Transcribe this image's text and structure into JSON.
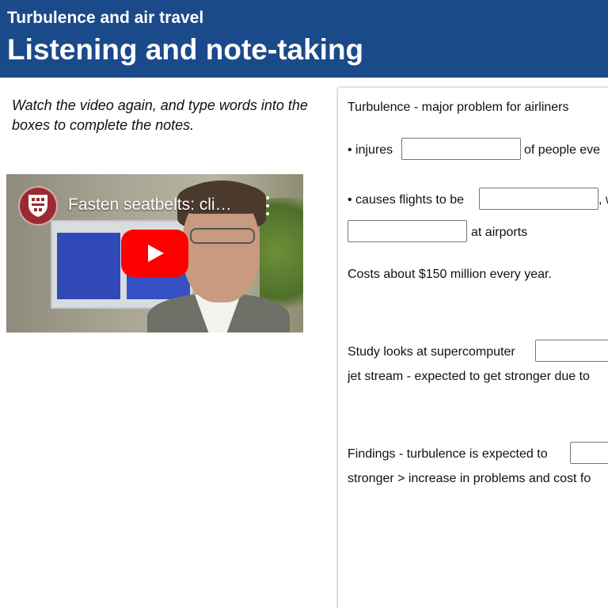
{
  "header": {
    "subtitle": "Turbulence and air travel",
    "title": "Listening and note-taking"
  },
  "instructions": "Watch the video again, and type words into the boxes to complete the notes.",
  "video": {
    "title": "Fasten seatbelts: cli…",
    "channel_icon": "university-crest-icon",
    "play_icon": "youtube-play-icon",
    "more_icon": "more-vertical-icon"
  },
  "notes": {
    "heading": "Turbulence - major problem for airliners",
    "bullet1_prefix": "• injures",
    "bullet1_suffix": "of people eve",
    "bullet2_prefix": "• causes flights to be",
    "bullet2_comma": ", w",
    "bullet2_line2_suffix": "at airports",
    "costs": "Costs about $150 million every year.",
    "study_prefix": "Study looks at supercomputer",
    "study_line2": "jet stream - expected to get stronger due to",
    "findings_prefix": "Findings - turbulence is expected to",
    "findings_line2": "stronger > increase in problems and cost fo"
  },
  "colors": {
    "header_bg": "#1b4a8a",
    "play_red": "#ff0000"
  }
}
